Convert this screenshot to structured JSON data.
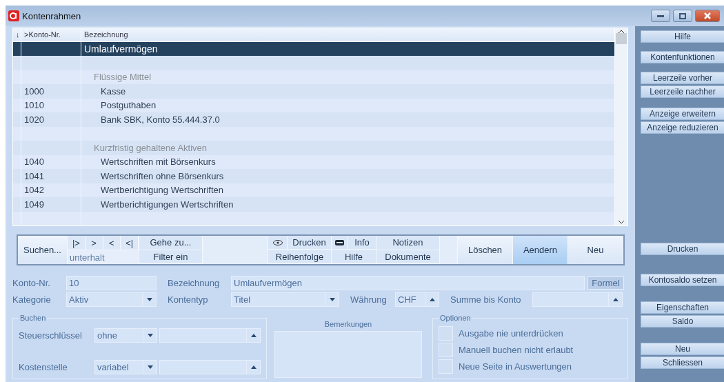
{
  "window": {
    "title": "Kontenrahmen"
  },
  "table": {
    "columns": [
      "↓",
      ">Konto-Nr.",
      "Bezeichnung"
    ],
    "rows": [
      {
        "kind": "title",
        "konto": "",
        "bezeichnung": "Umlaufvermögen",
        "selected": true
      },
      {
        "kind": "blank",
        "konto": "",
        "bezeichnung": "",
        "selected": false
      },
      {
        "kind": "group",
        "konto": "",
        "bezeichnung": "Flüssige Mittel",
        "selected": false
      },
      {
        "kind": "account",
        "konto": "1000",
        "bezeichnung": "Kasse",
        "selected": false
      },
      {
        "kind": "account",
        "konto": "1010",
        "bezeichnung": "Postguthaben",
        "selected": false
      },
      {
        "kind": "account",
        "konto": "1020",
        "bezeichnung": "Bank SBK, Konto 55.444.37.0",
        "selected": false
      },
      {
        "kind": "blank",
        "konto": "",
        "bezeichnung": "",
        "selected": false
      },
      {
        "kind": "group",
        "konto": "",
        "bezeichnung": "Kurzfristig gehaltene Aktiven",
        "selected": false
      },
      {
        "kind": "account",
        "konto": "1040",
        "bezeichnung": "Wertschriften mit Börsenkurs",
        "selected": false
      },
      {
        "kind": "account",
        "konto": "1041",
        "bezeichnung": "Wertschriften ohne Börsenkurs",
        "selected": false
      },
      {
        "kind": "account",
        "konto": "1042",
        "bezeichnung": "Wertberichtigung Wertschriften",
        "selected": false
      },
      {
        "kind": "account",
        "konto": "1049",
        "bezeichnung": "Wertberichtigungen Wertschriften",
        "selected": false
      },
      {
        "kind": "blank",
        "konto": "",
        "bezeichnung": "",
        "selected": false
      }
    ]
  },
  "toolbar": {
    "search": "Suchen...",
    "nav": [
      "|>",
      ">",
      "<",
      "<|"
    ],
    "search_field": {
      "value": "unterhalt"
    },
    "goto": "Gehe zu...",
    "filter": "Filter ein",
    "print": "Drucken",
    "order": "Reihenfolge",
    "info": "Info",
    "help": "Hilfe",
    "notes": "Notizen",
    "documents": "Dokumente",
    "actions": [
      {
        "label": "Löschen",
        "selected": false
      },
      {
        "label": "Aendern",
        "selected": true
      },
      {
        "label": "Neu",
        "selected": false
      }
    ]
  },
  "form": {
    "konto_nr": {
      "label": "Konto-Nr.",
      "value": "10"
    },
    "bezeichnung": {
      "label": "Bezeichnung",
      "value": "Umlaufvermögen"
    },
    "formel": "Formel",
    "kategorie": {
      "label": "Kategorie",
      "value": "Aktiv",
      "kind": "dropdown"
    },
    "kontentyp": {
      "label": "Kontentyp",
      "value": "Titel",
      "kind": "dropdown"
    },
    "waehrung": {
      "label": "Währung",
      "value": "CHF",
      "kind": "popup"
    },
    "summe": {
      "label": "Summe bis Konto",
      "kind": "popup"
    }
  },
  "buchen": {
    "title": "Buchen",
    "rows": [
      {
        "label": "Steuerschlüssel",
        "select": {
          "value": "ohne",
          "kind": "dropdown"
        },
        "lookup": {
          "kind": "popup"
        }
      },
      {
        "label": "Kostenstelle",
        "select": {
          "value": "variabel",
          "kind": "dropdown"
        },
        "lookup": {
          "kind": "popup"
        }
      }
    ]
  },
  "bemerkungen": {
    "title": "Bemerkungen"
  },
  "optionen": {
    "title": "Optionen",
    "items": [
      {
        "label": "Ausgabe nie unterdrücken",
        "checked": false
      },
      {
        "label": "Manuell buchen nicht erlaubt",
        "checked": false
      },
      {
        "label": "Neue Seite in Auswertungen",
        "checked": false
      }
    ]
  },
  "sidebar": {
    "groups": [
      [
        "Hilfe"
      ],
      [
        "Kontenfunktionen"
      ],
      [
        "Leerzeile vorher",
        "Leerzeile nachher"
      ],
      [
        "Anzeige erweitern",
        "Anzeige reduzieren"
      ],
      [
        "Drucken"
      ],
      [
        "Kontosaldo setzen"
      ],
      [
        "Eigenschaften",
        "Saldo"
      ],
      [
        "Neu",
        "Schliessen"
      ]
    ]
  }
}
